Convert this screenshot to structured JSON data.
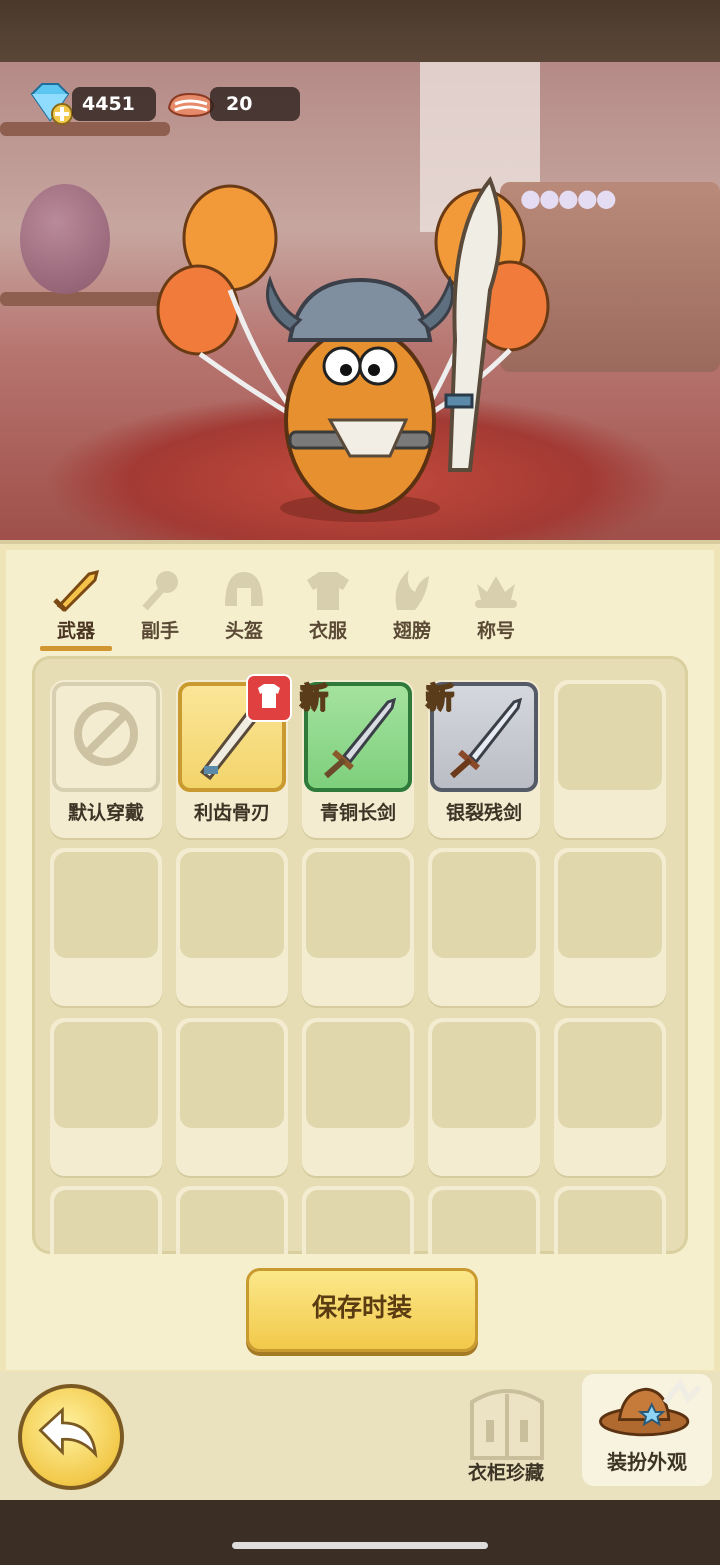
{
  "resources": {
    "gems": {
      "icon": "diamond-plus-icon",
      "value": "4451"
    },
    "meat": {
      "icon": "meat-icon",
      "value": "20"
    }
  },
  "tabs": [
    {
      "label": "武器",
      "icon": "sword-icon",
      "active": true
    },
    {
      "label": "副手",
      "icon": "mace-icon",
      "active": false
    },
    {
      "label": "头盔",
      "icon": "helmet-icon",
      "active": false
    },
    {
      "label": "衣服",
      "icon": "armor-icon",
      "active": false
    },
    {
      "label": "翅膀",
      "icon": "wing-icon",
      "active": false
    },
    {
      "label": "称号",
      "icon": "crown-icon",
      "active": false
    }
  ],
  "items": [
    {
      "name": "默认穿戴",
      "icon": "prohibited-icon",
      "rarity": "default",
      "is_new": false,
      "equipped": false
    },
    {
      "name": "利齿骨刃",
      "icon": "bone-blade-icon",
      "rarity": "gold",
      "is_new": false,
      "equipped": true
    },
    {
      "name": "青铜长剑",
      "icon": "bronze-sword-icon",
      "rarity": "green",
      "is_new": true,
      "equipped": false
    },
    {
      "name": "银裂残剑",
      "icon": "silver-sword-icon",
      "rarity": "gray",
      "is_new": true,
      "equipped": false
    }
  ],
  "new_badge": "新",
  "save_button": "保存时装",
  "bottom": {
    "wardrobe_label": "衣柜珍藏",
    "dressup_label": "装扮外观"
  },
  "colors": {
    "accent": "#d19531",
    "panel": "#f6efce",
    "gold_rarity": "#f3d469",
    "green_rarity": "#7ccf7b",
    "gray_rarity": "#b9bcc4"
  }
}
